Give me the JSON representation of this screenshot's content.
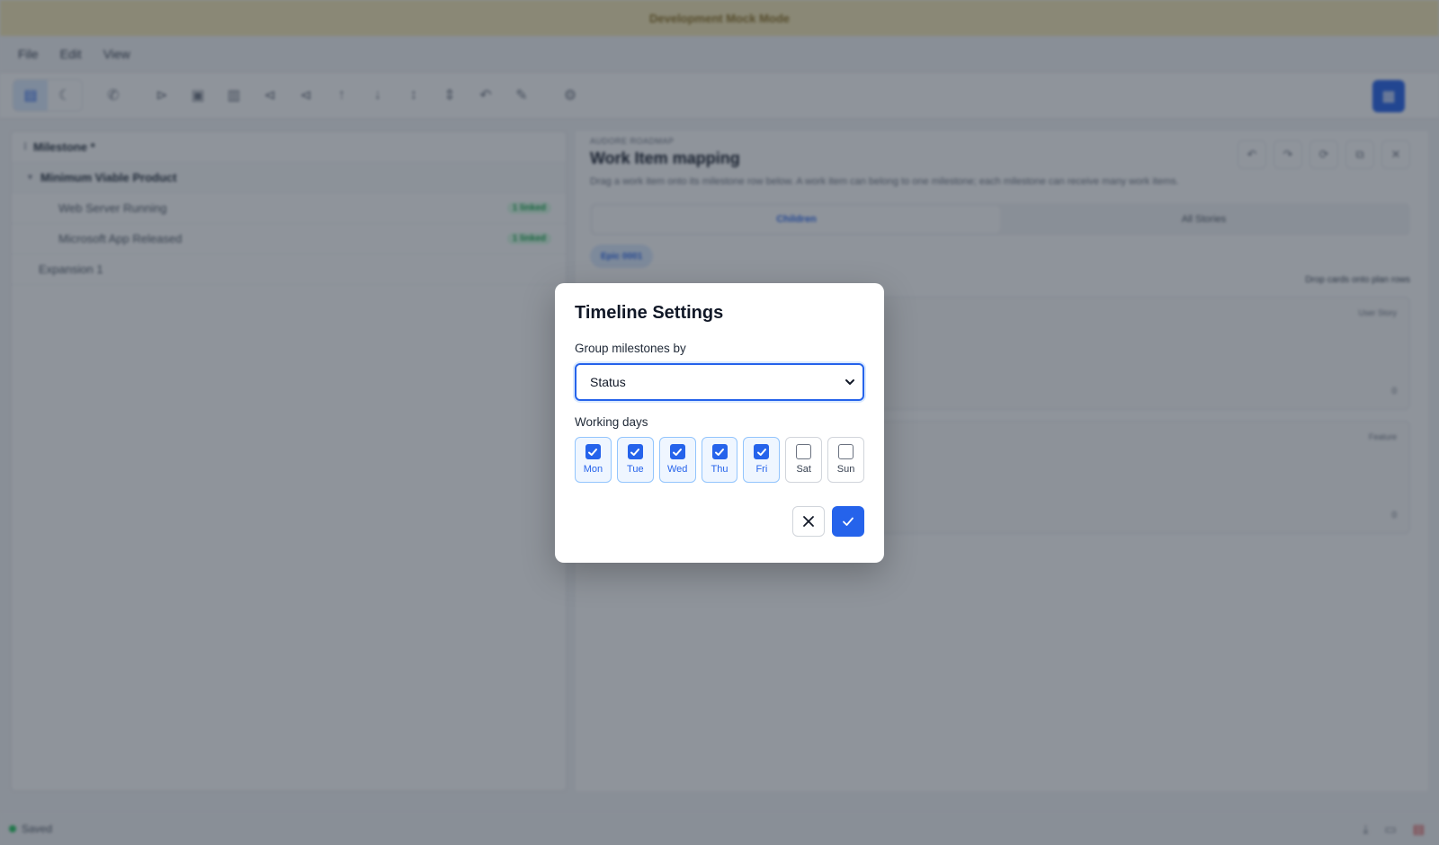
{
  "banner": {
    "text": "Development Mock Mode"
  },
  "menu": {
    "file": "File",
    "edit": "Edit",
    "view": "View"
  },
  "tree": {
    "root": "Milestone *",
    "group": "Minimum Viable Product",
    "items": [
      {
        "label": "Web Server Running",
        "badge": "1 linked"
      },
      {
        "label": "Microsoft App Released",
        "badge": "1 linked"
      }
    ],
    "other": "Expansion 1"
  },
  "detail": {
    "breadcrumb": "AUDORE ROADMAP",
    "title": "Work Item mapping",
    "description": "Drag a work item onto its milestone row below. A work item can belong to one milestone; each milestone can receive many work items.",
    "tabs": [
      "Children",
      "All Stories"
    ],
    "chip": "Epic 0001",
    "hint": "Drop cards onto plan rows",
    "cards": [
      {
        "label": "User Story",
        "count": "0"
      },
      {
        "label": "Feature",
        "count": "0"
      }
    ]
  },
  "status": {
    "text": "Saved"
  },
  "modal": {
    "title": "Timeline Settings",
    "group_label": "Group milestones by",
    "group_value": "Status",
    "working_days_label": "Working days",
    "days": [
      {
        "label": "Mon",
        "checked": true
      },
      {
        "label": "Tue",
        "checked": true
      },
      {
        "label": "Wed",
        "checked": true
      },
      {
        "label": "Thu",
        "checked": true
      },
      {
        "label": "Fri",
        "checked": true
      },
      {
        "label": "Sat",
        "checked": false
      },
      {
        "label": "Sun",
        "checked": false
      }
    ]
  },
  "colors": {
    "accent": "#2563eb",
    "accent_light": "#eff6ff",
    "banner": "#f5e7b4",
    "success": "#22c55e"
  }
}
